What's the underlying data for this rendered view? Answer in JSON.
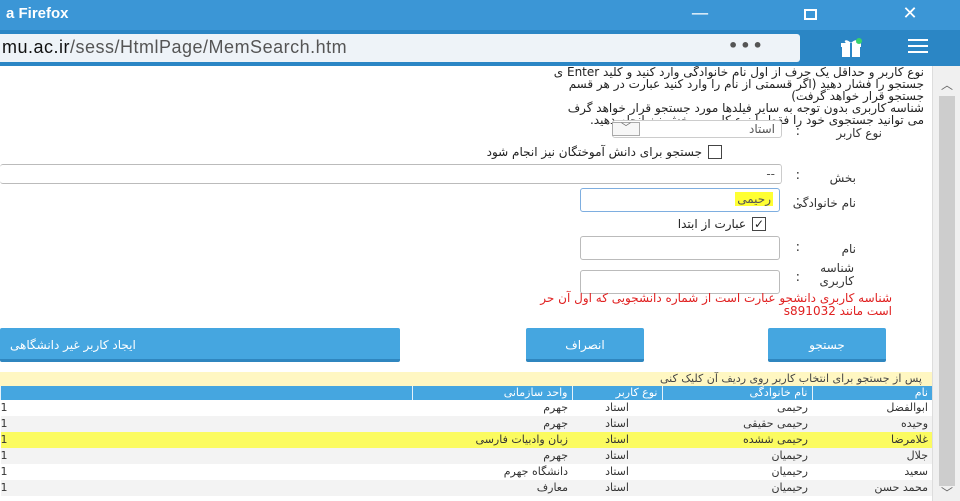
{
  "window": {
    "title": "a Firefox",
    "minimize": "—",
    "close": "✕"
  },
  "toolbar": {
    "url_domain": "mu.ac.ir",
    "url_path": "/sess/HtmlPage/MemSearch.htm",
    "page_actions": "•••",
    "icons": [
      "gift-icon",
      "hamburger-menu-icon"
    ]
  },
  "help_text": [
    "نوع کاربر و حداقل یک حرف از اول نام خانوادگی وارد کنید و کلید Enter ی",
    "جستجو را فشار دهید (اگر قسمتی از نام را وارد کنید عبارت در هر قسم",
    "جستجو قرار خواهد گرفت)",
    "شناسه کاربری بدون توجه به سایر فیلدها مورد جستجو قرار خواهد گرف",
    "می توانید جستجوی خود را فقط با نوع کاربر و بخش نیز انجام دهید."
  ],
  "form": {
    "user_type_label": "نوع کاربر",
    "user_type_value": "استاد",
    "include_students_label": "جستجو برای دانش آموختگان نیز انجام شود",
    "department_label": "بخش",
    "department_value": "--",
    "lastname_label": "نام خانوادگی",
    "lastname_value": "رحیمی",
    "from_start_label": "عبارت از ابتدا",
    "firstname_label": "نام",
    "userid_label": "شناسه کاربری",
    "colon": ":",
    "error_line1": "شناسه کاربری دانشجو عبارت است از شماره دانشجویی که اول آن حر",
    "error_line2": "است مانند s891032"
  },
  "buttons": {
    "search": "جستجو",
    "cancel": "انصراف",
    "create_external": "ایجاد کاربر غیر دانشگاهی"
  },
  "results_note": "پس از جستجو برای انتخاب کاربر روی ردیف آن کلیک کنی",
  "results": {
    "headers": [
      "نام",
      "نام خانوادگی",
      "نوع کاربر",
      "واحد سازمانی"
    ],
    "rows": [
      {
        "first": "ابوالفضل",
        "last": "رحیمی",
        "type": "استاد",
        "unit": "جهرم",
        "edge": "1"
      },
      {
        "first": "وحیده",
        "last": "رحیمی حقیقی",
        "type": "استاد",
        "unit": "جهرم",
        "edge": "1"
      },
      {
        "first": "غلامرضا",
        "last": "رحیمی ششده",
        "type": "استاد",
        "unit": "زبان وادبیات فارسی",
        "edge": "1"
      },
      {
        "first": "جلال",
        "last": "رحیمیان",
        "type": "استاد",
        "unit": "جهرم",
        "edge": "1"
      },
      {
        "first": "سعید",
        "last": "رحیمیان",
        "type": "استاد",
        "unit": "دانشگاه جهرم",
        "edge": "1"
      },
      {
        "first": "محمد حسن",
        "last": "رحیمیان",
        "type": "استاد",
        "unit": "معارف",
        "edge": "1"
      }
    ]
  },
  "colors": {
    "titlebar": "#3b96d6",
    "urlbar": "#2b86c5",
    "accent": "#45a6e0",
    "error": "#e02020",
    "highlight": "#ffff33"
  }
}
